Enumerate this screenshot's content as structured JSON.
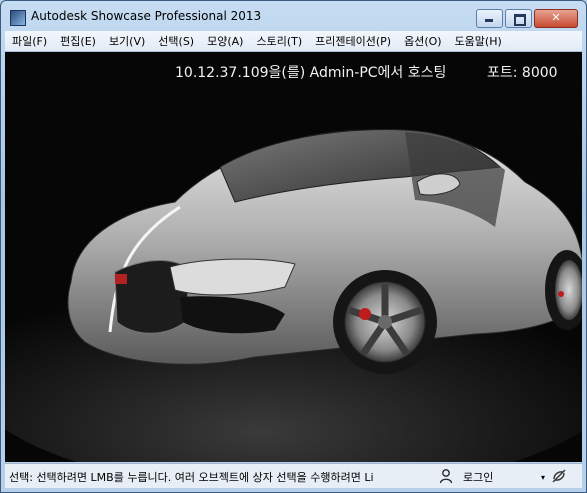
{
  "window": {
    "title": "Autodesk Showcase Professional 2013",
    "minimize_glyph": "",
    "close_glyph": "✕"
  },
  "menu": [
    {
      "label": "파일(F)"
    },
    {
      "label": "편집(E)"
    },
    {
      "label": "보기(V)"
    },
    {
      "label": "선택(S)"
    },
    {
      "label": "모양(A)"
    },
    {
      "label": "스토리(T)"
    },
    {
      "label": "프리젠테이션(P)"
    },
    {
      "label": "옵션(O)"
    },
    {
      "label": "도움말(H)"
    }
  ],
  "viewport": {
    "host_info": "10.12.37.109을(를) Admin-PC에서 호스팅",
    "port_info": "포트: 8000",
    "background_color": "#060606",
    "car_color": "#b8b8b8"
  },
  "status": {
    "message": "선택: 선택하려면 LMB를 누릅니다. 여러 오브젝트에 상자 선택을 수행하려면 Li",
    "login_label": "로그인",
    "user_icon": "user-search-icon",
    "dropdown_glyph": "▾",
    "sync_icon": "disconnect-icon"
  }
}
